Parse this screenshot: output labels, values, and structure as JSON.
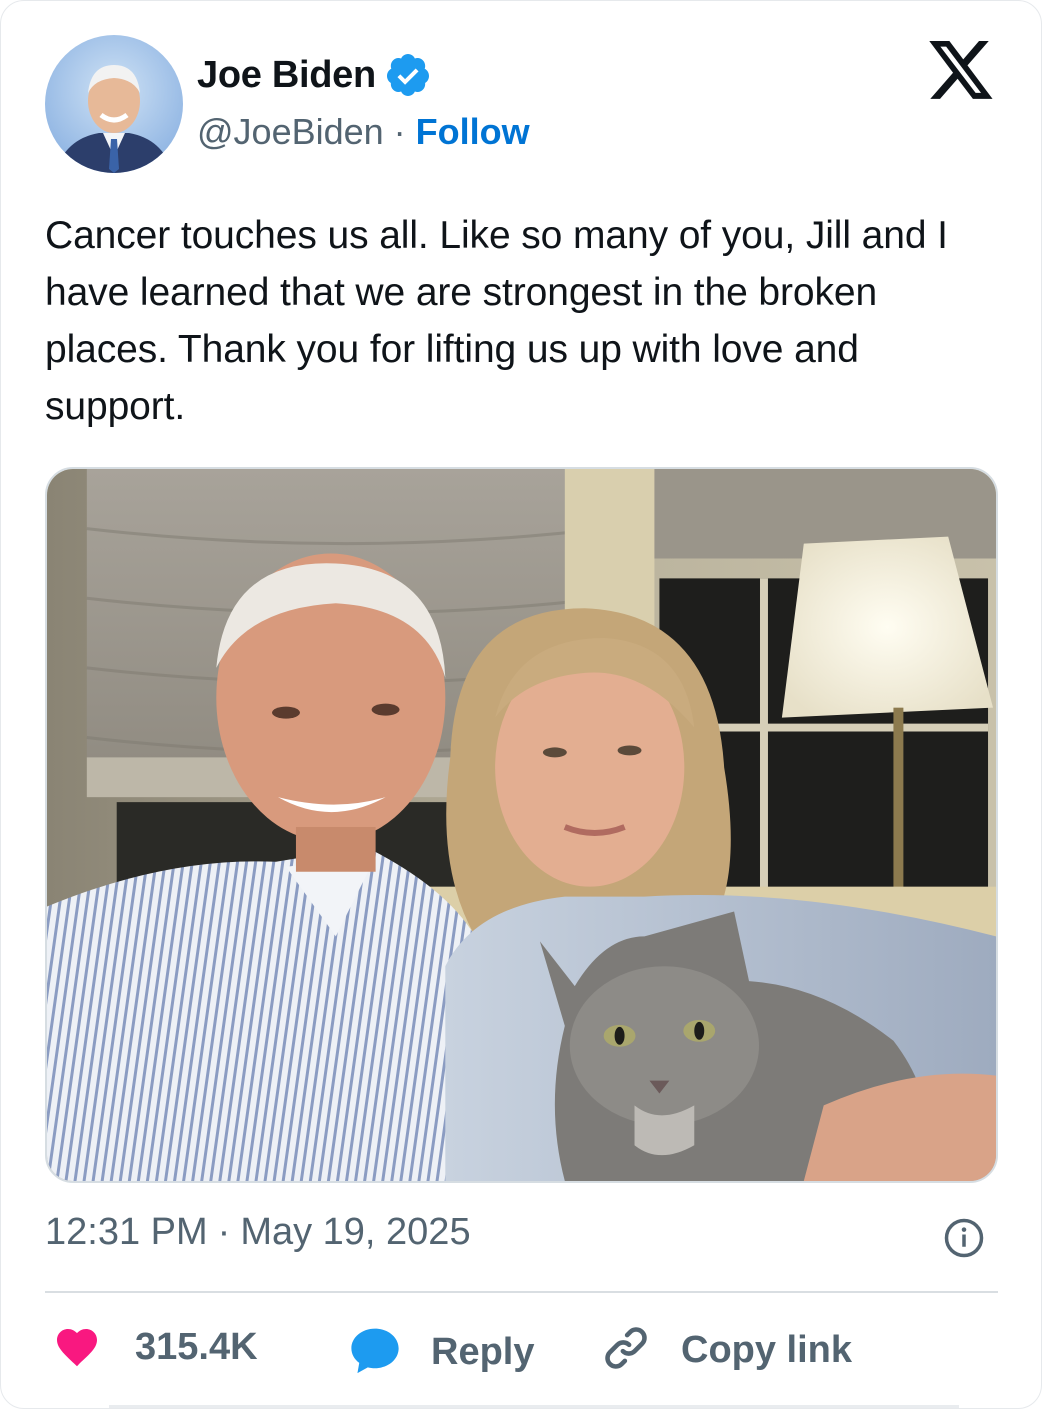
{
  "author": {
    "name": "Joe Biden",
    "handle": "@JoeBiden",
    "separator": "·",
    "follow_label": "Follow",
    "verified_icon": "verified-badge-icon"
  },
  "tweet": {
    "text": "Cancer touches us all. Like so many of you, Jill and I have learned that we are strongest in the broken places. Thank you for lifting us up with love and support."
  },
  "meta": {
    "time": "12:31 PM",
    "separator": "·",
    "date": "May 19, 2025"
  },
  "actions": {
    "likes_count": "315.4K",
    "reply_label": "Reply",
    "copy_link_label": "Copy link"
  },
  "colors": {
    "like": "#f91880",
    "reply": "#1d9bf0",
    "follow": "#0074d4",
    "verified": "#1d9bf0"
  }
}
